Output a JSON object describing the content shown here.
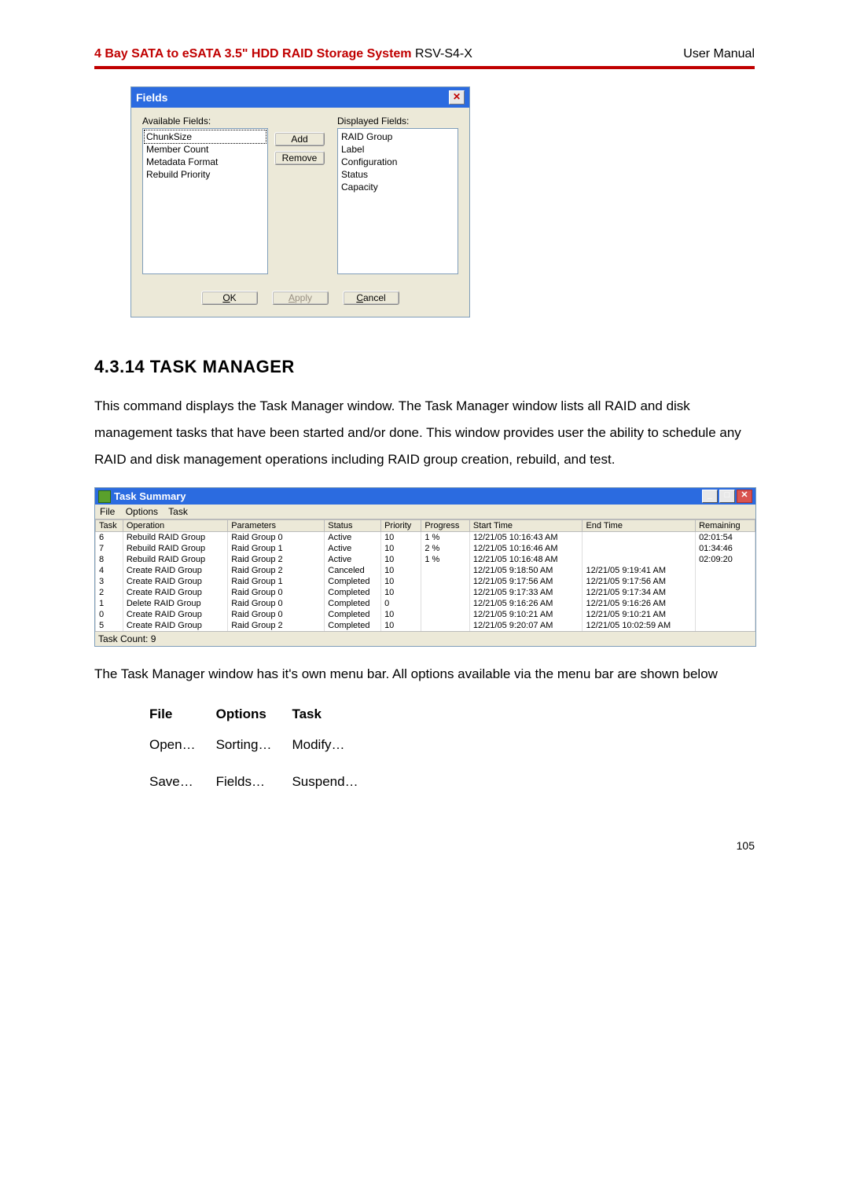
{
  "header": {
    "title_bold": "4 Bay SATA to eSATA 3.5\" HDD RAID Storage System",
    "model": " RSV-S4-X",
    "right": "User Manual"
  },
  "fields_dialog": {
    "title": "Fields",
    "available_label": "Available Fields:",
    "displayed_label": "Displayed Fields:",
    "available": [
      "ChunkSize",
      "Member Count",
      "Metadata Format",
      "Rebuild Priority"
    ],
    "displayed": [
      "RAID Group",
      "Label",
      "Configuration",
      "Status",
      "Capacity"
    ],
    "add_btn": "Add",
    "remove_btn": "Remove",
    "ok_btn": "OK",
    "apply_btn": "Apply",
    "cancel_btn": "Cancel"
  },
  "section": {
    "heading": "4.3.14  TASK MANAGER",
    "para1": "This command displays the Task Manager window. The Task Manager window lists all RAID and disk management tasks that have been started and/or done. This window provides user the ability to schedule any RAID and disk management operations including RAID group creation, rebuild, and test.",
    "para2": "The Task Manager window has it's own menu bar.  All options available via the menu bar are shown below"
  },
  "task_window": {
    "title": "Task Summary",
    "menu": [
      "File",
      "Options",
      "Task"
    ],
    "columns": [
      "Task",
      "Operation",
      "Parameters",
      "Status",
      "Priority",
      "Progress",
      "Start Time",
      "End Time",
      "Remaining"
    ],
    "rows": [
      [
        "6",
        "Rebuild RAID Group",
        "Raid Group 0",
        "Active",
        "10",
        "1 %",
        "12/21/05 10:16:43 AM",
        "",
        "02:01:54"
      ],
      [
        "7",
        "Rebuild RAID Group",
        "Raid Group 1",
        "Active",
        "10",
        "2 %",
        "12/21/05 10:16:46 AM",
        "",
        "01:34:46"
      ],
      [
        "8",
        "Rebuild RAID Group",
        "Raid Group 2",
        "Active",
        "10",
        "1 %",
        "12/21/05 10:16:48 AM",
        "",
        "02:09:20"
      ],
      [
        "4",
        "Create RAID Group",
        "Raid Group 2",
        "Canceled",
        "10",
        "",
        "12/21/05 9:18:50 AM",
        "12/21/05 9:19:41 AM",
        ""
      ],
      [
        "3",
        "Create RAID Group",
        "Raid Group 1",
        "Completed",
        "10",
        "",
        "12/21/05 9:17:56 AM",
        "12/21/05 9:17:56 AM",
        ""
      ],
      [
        "2",
        "Create RAID Group",
        "Raid Group 0",
        "Completed",
        "10",
        "",
        "12/21/05 9:17:33 AM",
        "12/21/05 9:17:34 AM",
        ""
      ],
      [
        "1",
        "Delete RAID Group",
        "Raid Group 0",
        "Completed",
        "0",
        "",
        "12/21/05 9:16:26 AM",
        "12/21/05 9:16:26 AM",
        ""
      ],
      [
        "0",
        "Create RAID Group",
        "Raid Group 0",
        "Completed",
        "10",
        "",
        "12/21/05 9:10:21 AM",
        "12/21/05 9:10:21 AM",
        ""
      ],
      [
        "5",
        "Create RAID Group",
        "Raid Group 2",
        "Completed",
        "10",
        "",
        "12/21/05 9:20:07 AM",
        "12/21/05 10:02:59 AM",
        ""
      ]
    ],
    "footer": "Task Count: 9"
  },
  "menu_options": {
    "headers": [
      "File",
      "Options",
      "Task"
    ],
    "rows": [
      [
        "Open…",
        "Sorting…",
        "Modify…"
      ],
      [
        "Save…",
        "Fields…",
        "Suspend…"
      ]
    ]
  },
  "page_number": "105"
}
